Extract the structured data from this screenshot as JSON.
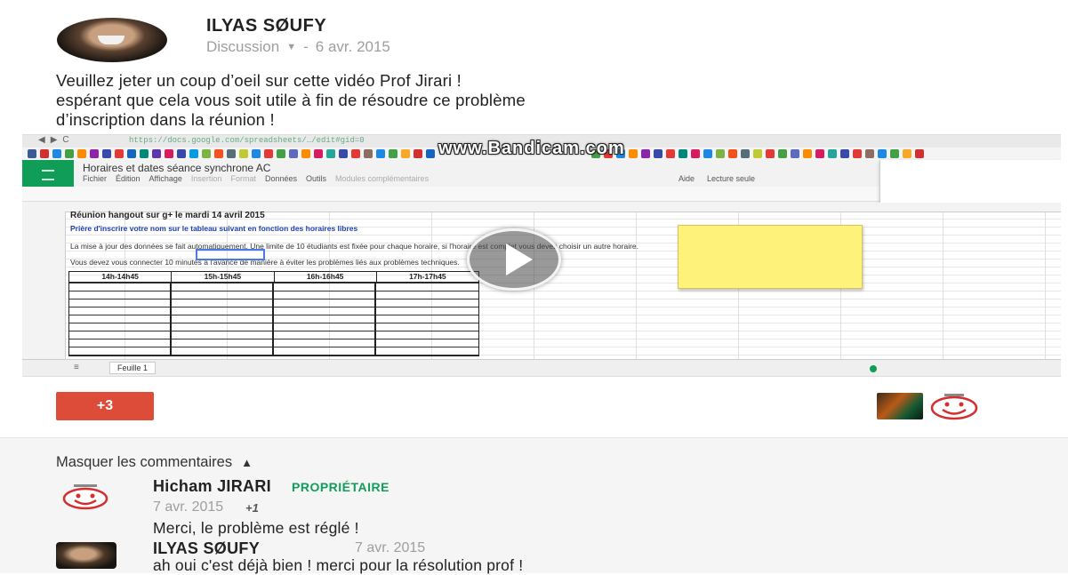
{
  "post": {
    "author": "ILYAS SØUFY",
    "category": "Discussion",
    "separator": "-",
    "date": "6 avr. 2015",
    "text_lines": [
      "Veuillez jeter un coup d’oeil sur cette vidéo Prof Jirari !",
      "espérant que cela vous soit utile à fin de résoudre ce problème",
      "d’inscription dans la réunion !"
    ],
    "plus_count": "+3"
  },
  "video": {
    "watermark": "www.Bandicam.com",
    "url_text": "https://docs.google.com/spreadsheets/…/edit#gid=0",
    "sheet_title": "Horaires et dates séance synchrone AC",
    "menu": [
      "Fichier",
      "Édition",
      "Affichage",
      "Insertion",
      "Format",
      "Données",
      "Outils",
      "Modules complémentaires"
    ],
    "menu_right": [
      "Aide",
      "Lecture seule"
    ],
    "cell_title": "Réunion hangout sur g+ le mardi 14 avril 2015",
    "cell_instructions": "Prière d'inscrire votre nom sur le tableau suivant en fonction des horaires libres",
    "cell_line3": "La mise à jour des données se fait automatiquement. Une limite de 10 étudiants est fixée pour chaque horaire, si l'horaire est complet vous devez choisir un autre horaire.",
    "cell_line4": "Vous devez vous connecter 10 minutes à l'avance de manière à éviter les problèmes liés aux problèmes techniques.",
    "time_slots": [
      "14h-14h45",
      "15h-15h45",
      "16h-16h45",
      "17h-17h45"
    ],
    "sheet_tab": "Feuille 1"
  },
  "comments": {
    "toggle_label": "Masquer les commentaires",
    "items": [
      {
        "author": "Hicham JIRARI",
        "badge": "PROPRIÉTAIRE",
        "date": "7 avr. 2015",
        "plus": "+1",
        "text": "Merci, le problème est réglé !"
      },
      {
        "author": "ILYAS SØUFY",
        "date": "7 avr. 2015",
        "text": "ah oui c'est déjà bien ! merci pour la résolution prof !"
      }
    ]
  },
  "colors": {
    "plus_button": "#dd4b39",
    "owner_badge": "#0f9d58",
    "meta_gray": "#9e9e9e",
    "sheets_green": "#0f9d58",
    "sticky_note": "#fff27a"
  }
}
